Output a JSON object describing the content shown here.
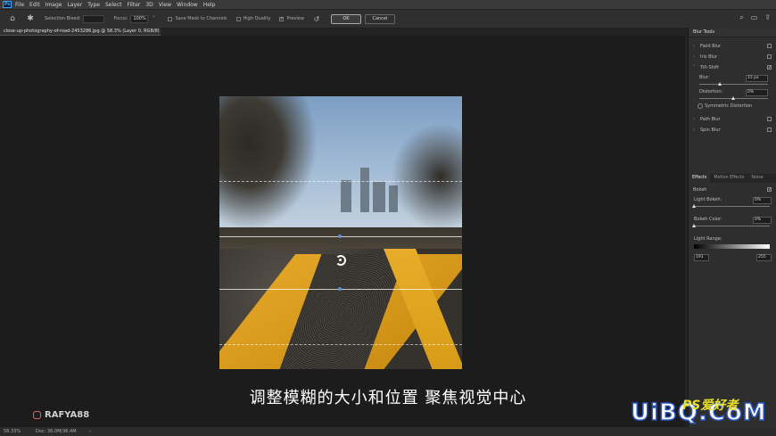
{
  "menu": [
    "File",
    "Edit",
    "Image",
    "Layer",
    "Type",
    "Select",
    "Filter",
    "3D",
    "View",
    "Window",
    "Help"
  ],
  "app_logo": "Ps",
  "options": {
    "selection_bleed_label": "Selection Bleed:",
    "focus_label": "Focus:",
    "focus_value": "100%",
    "save_mask_label": "Save Mask to Channels",
    "high_quality_label": "High Quality",
    "preview_label": "Preview",
    "ok_label": "OK",
    "cancel_label": "Cancel"
  },
  "document_tab": "close-up-photography-of-road-2453286.jpg @ 58.3% (Layer 0, RGB/8) *",
  "blur_tools": {
    "title": "Blur Tools",
    "field_blur": "Field Blur",
    "iris_blur": "Iris Blur",
    "tilt_shift": "Tilt-Shift",
    "blur_label": "Blur:",
    "blur_value": "15 px",
    "blur_level": 0.3,
    "distortion_label": "Distortion:",
    "distortion_value": "0%",
    "distortion_level": 0.5,
    "symmetric_label": "Symmetric Distortion",
    "path_blur": "Path Blur",
    "spin_blur": "Spin Blur"
  },
  "effects_tabs": [
    "Effects",
    "Motion Effects",
    "Noise"
  ],
  "effects": {
    "bokeh_label": "Bokeh",
    "light_bokeh_label": "Light Bokeh:",
    "light_bokeh_value": "0%",
    "bokeh_color_label": "Bokeh Color:",
    "bokeh_color_value": "0%",
    "light_range_label": "Light Range:",
    "range_low": "191",
    "range_high": "255"
  },
  "subtitle": "调整模糊的大小和位置 聚焦视觉中心",
  "credit": "RAFYA88",
  "status": {
    "zoom": "58.33%",
    "doc": "Doc: 36.0M/36.4M"
  },
  "watermark": {
    "main": "UiBQ.CoM",
    "top": "PS爱好者"
  },
  "colors": {
    "accent_blue": "#31a8ff",
    "road_line_yellow": "#e2a526",
    "watermark_blue": "#2a58c8",
    "watermark_yellow": "#e8e028"
  }
}
